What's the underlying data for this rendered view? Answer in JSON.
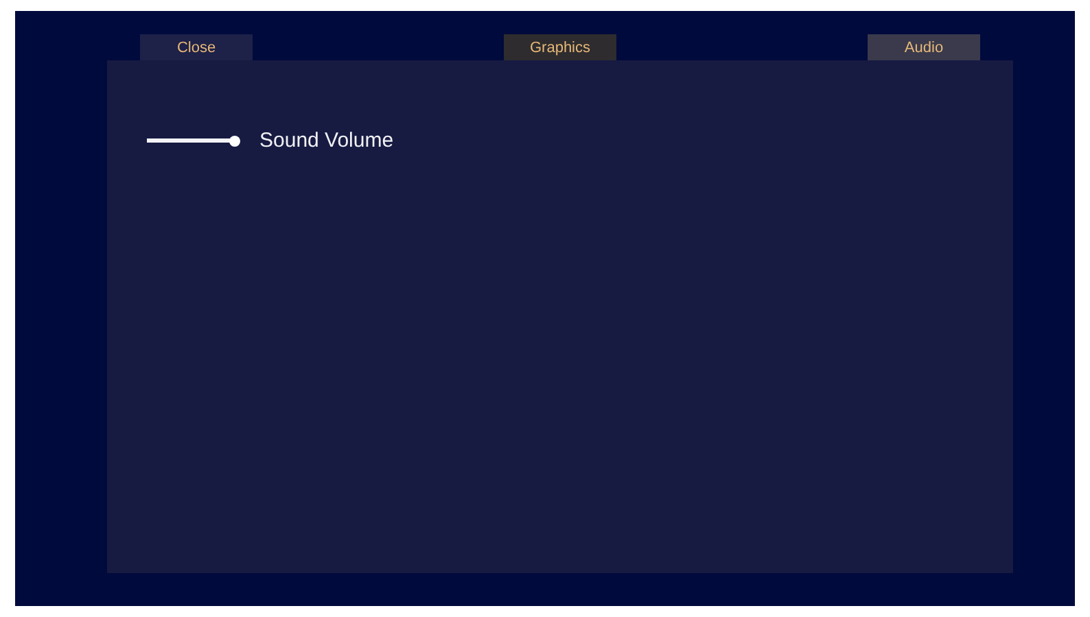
{
  "tabs": [
    {
      "label": "Close",
      "color": "#1e2148"
    },
    {
      "label": "Graphics",
      "color": "#2e2c2e"
    },
    {
      "label": "Audio",
      "color": "#3a3a4c"
    }
  ],
  "settings": [
    {
      "kind": "slider",
      "label": "Sound Volume",
      "level": 1.0
    }
  ]
}
